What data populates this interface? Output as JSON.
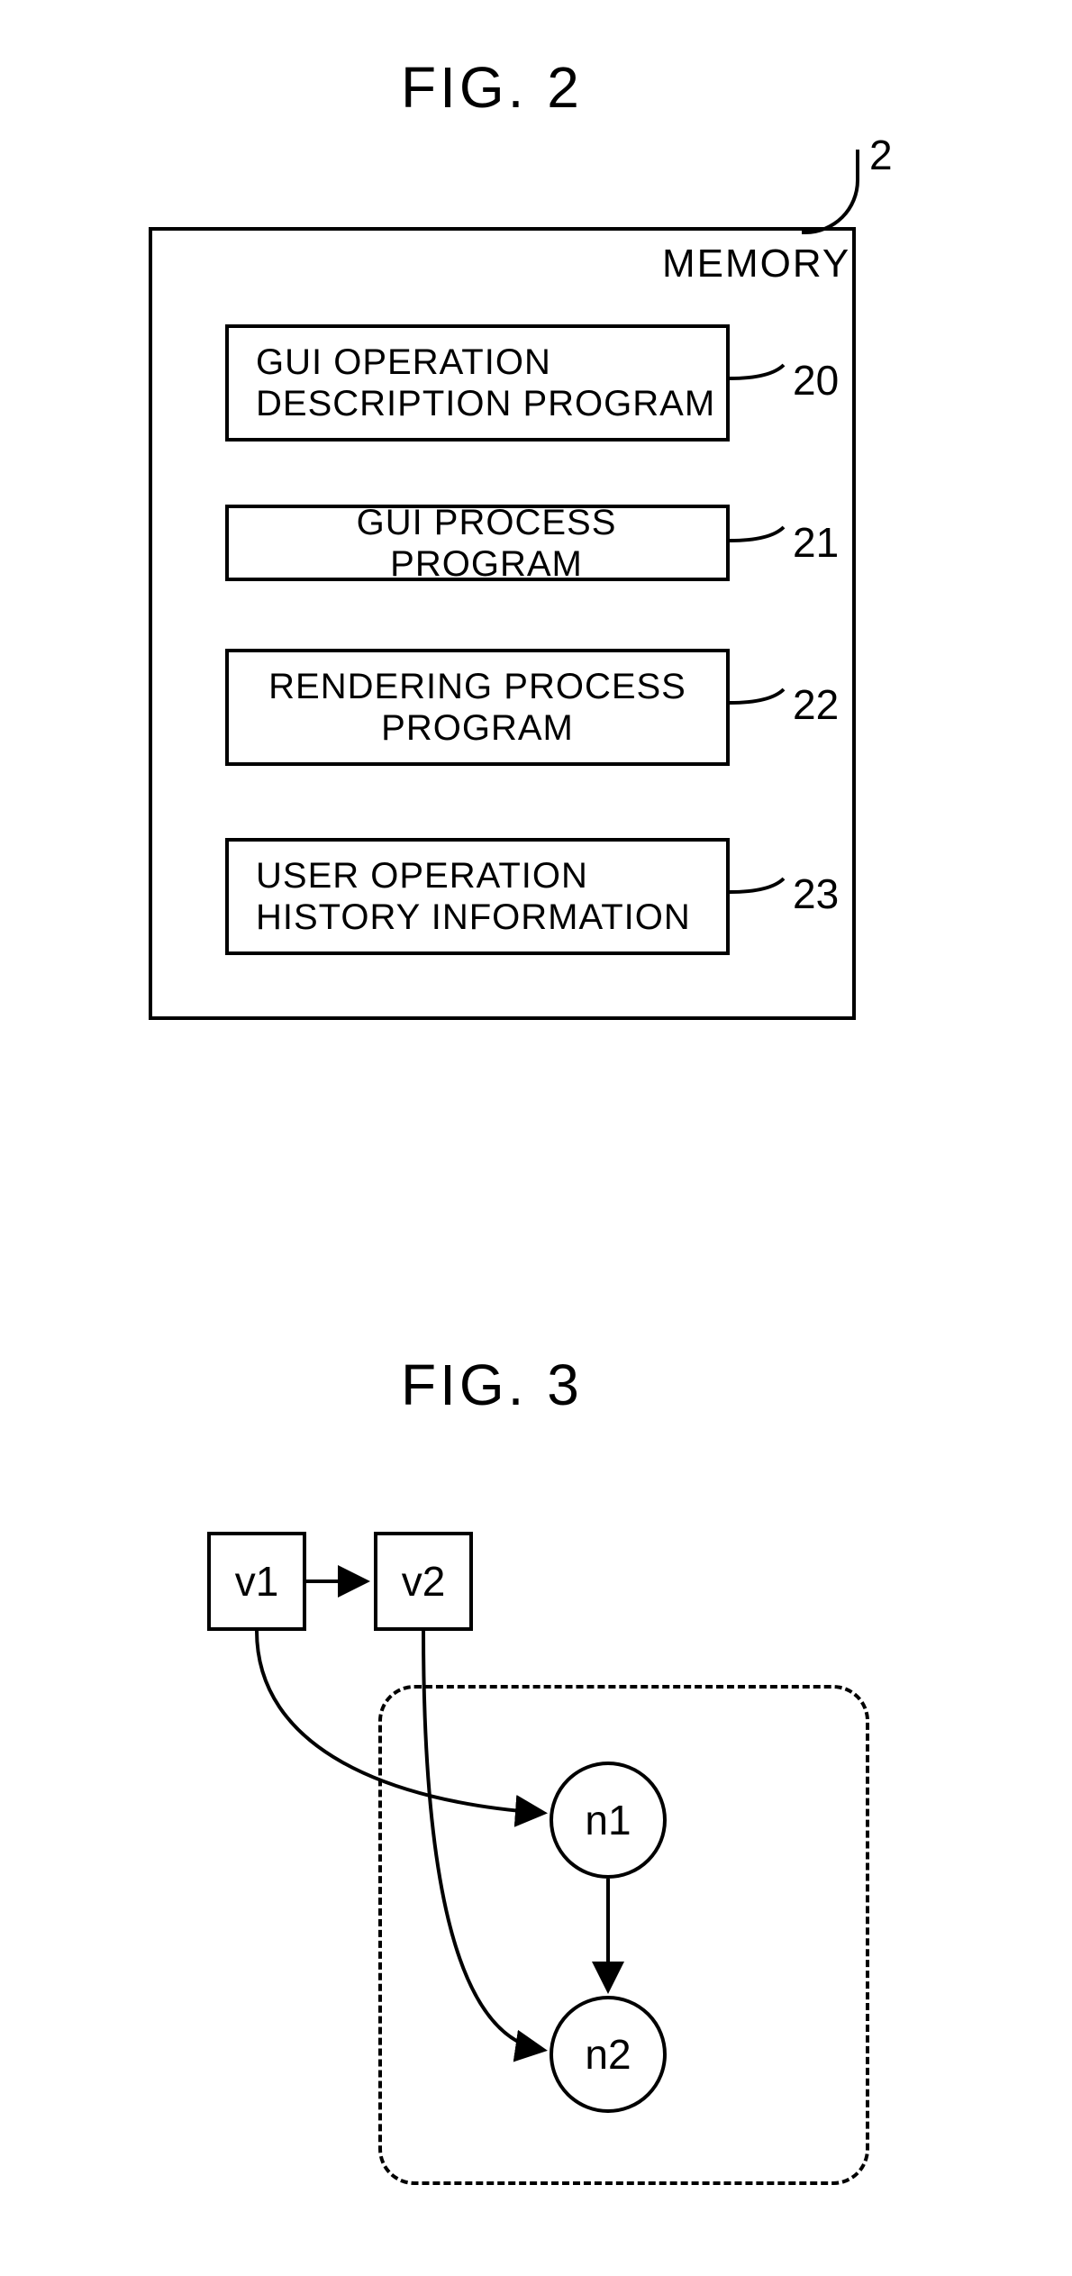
{
  "fig2": {
    "title": "FIG. 2",
    "container_ref": "2",
    "container_label": "MEMORY",
    "items": [
      {
        "label": "GUI OPERATION\nDESCRIPTION PROGRAM",
        "ref": "20"
      },
      {
        "label": "GUI PROCESS PROGRAM",
        "ref": "21"
      },
      {
        "label": "RENDERING PROCESS\nPROGRAM",
        "ref": "22"
      },
      {
        "label": "USER OPERATION\nHISTORY INFORMATION",
        "ref": "23"
      }
    ]
  },
  "fig3": {
    "title": "FIG. 3",
    "nodes": {
      "v1": "v1",
      "v2": "v2",
      "n1": "n1",
      "n2": "n2"
    }
  }
}
